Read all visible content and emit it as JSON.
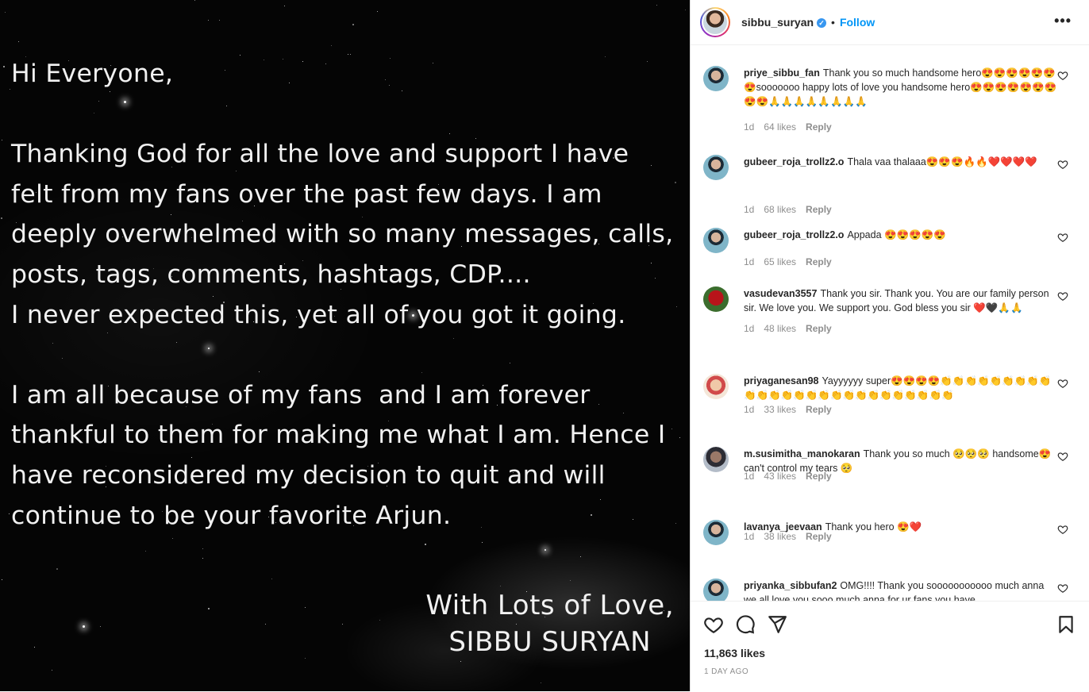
{
  "post": {
    "letter_lines": [
      "Hi Everyone,",
      "",
      "Thanking God for all the love and support I have",
      "felt from my fans over the past few days. I am",
      "deeply overwhelmed with so many messages, calls,",
      "posts, tags, comments, hashtags, CDP....",
      "I never expected this, yet all of you got it going.",
      "",
      "I am all because of my fans  and I am forever",
      "thankful to them for making me what I am. Hence I",
      "have reconsidered my decision to quit and will",
      "continue to be your favorite Arjun."
    ],
    "signoff_1": "With Lots of Love,",
    "signoff_2": "SIBBU SURYAN"
  },
  "header": {
    "username": "sibbu_suryan",
    "verified_mark": "✓",
    "separator": "•",
    "follow_label": "Follow",
    "more_label": "•••"
  },
  "comments": [
    {
      "user": "priye_sibbu_fan",
      "text": "Thank you so much handsome hero😍😍😍😍😍😍😍sooooooo happy lots of love you handsome hero😍😍😍😍😍😍😍😍😍🙏🙏🙏🙏🙏🙏🙏🙏",
      "age": "1d",
      "likes": "64 likes",
      "reply": "Reply",
      "avatar": "blue"
    },
    {
      "user": "gubeer_roja_trollz2.o",
      "text": "Thala vaa thalaaa😍😍😍🔥🔥❤️❤️❤️❤️",
      "age": "1d",
      "likes": "68 likes",
      "reply": "Reply",
      "avatar": "blue"
    },
    {
      "user": "gubeer_roja_trollz2.o",
      "text": "Appada 😍😍😍😍😍",
      "age": "1d",
      "likes": "65 likes",
      "reply": "Reply",
      "avatar": "blue"
    },
    {
      "user": "vasudevan3557",
      "text": "Thank you sir. Thank you. You are our family person sir. We love you. We support you. God bless you sir ❤️🖤🙏🙏",
      "age": "1d",
      "likes": "48 likes",
      "reply": "Reply",
      "avatar": "rose"
    },
    {
      "user": "priyaganesan98",
      "text": "Yayyyyyy super😍😍😍😍👏👏👏👏👏👏👏👏👏👏👏👏👏👏👏👏👏👏👏👏👏👏👏👏👏👏",
      "age": "1d",
      "likes": "33 likes",
      "reply": "Reply",
      "avatar": "girl"
    },
    {
      "user": "m.susimitha_manokaran",
      "text": "Thank you so much 🥺🥺🥺 handsome😍 can't control my tears 🥺",
      "age": "1d",
      "likes": "43 likes",
      "reply": "Reply",
      "avatar": "man"
    },
    {
      "user": "lavanya_jeevaan",
      "text": "Thank you hero 😍❤️",
      "age": "1d",
      "likes": "38 likes",
      "reply": "Reply",
      "avatar": "blue"
    },
    {
      "user": "priyanka_sibbufan2",
      "text": "OMG!!!! Thank you sooooooooooo much anna we all love you sooo much anna for ur fans you have",
      "age": "",
      "likes": "",
      "reply": "",
      "avatar": "blue"
    }
  ],
  "footer": {
    "likes": "11,863 likes",
    "time_ago": "1 DAY AGO"
  }
}
